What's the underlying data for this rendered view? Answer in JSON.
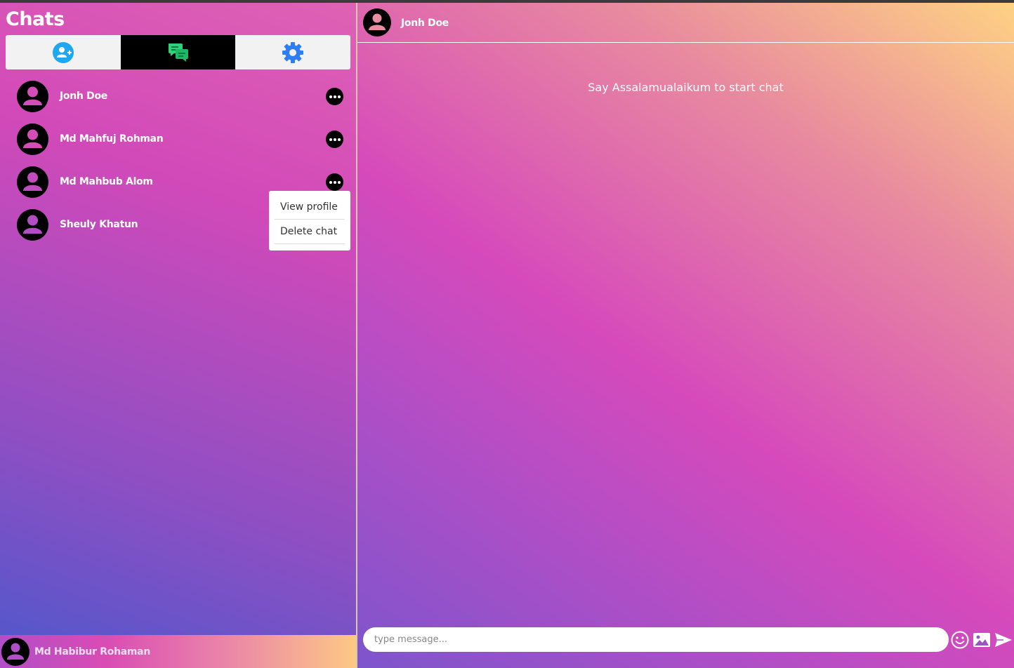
{
  "sidebar": {
    "title": "Chats",
    "tabs": [
      {
        "name": "add-contact",
        "icon": "user-plus-icon",
        "color": "#1fa7f0",
        "active": false
      },
      {
        "name": "chats",
        "icon": "chat-bubbles-icon",
        "color": "#27c96d",
        "active": true
      },
      {
        "name": "settings",
        "icon": "gear-icon",
        "color": "#2f7df5",
        "active": false
      }
    ],
    "chats": [
      {
        "name": "Jonh Doe"
      },
      {
        "name": "Md Mahfuj Rohman"
      },
      {
        "name": "Md Mahbub Alom"
      },
      {
        "name": "Sheuly Khatun"
      }
    ],
    "context_menu": {
      "items": [
        "View profile",
        "Delete chat"
      ]
    },
    "current_user": {
      "name": "Md Habibur Rohaman"
    }
  },
  "conversation": {
    "header_name": "Jonh Doe",
    "empty_message": "Say Assalamualaikum to start chat",
    "input_placeholder": "type message...",
    "actions": [
      "emoji-icon",
      "image-icon",
      "send-icon"
    ]
  }
}
